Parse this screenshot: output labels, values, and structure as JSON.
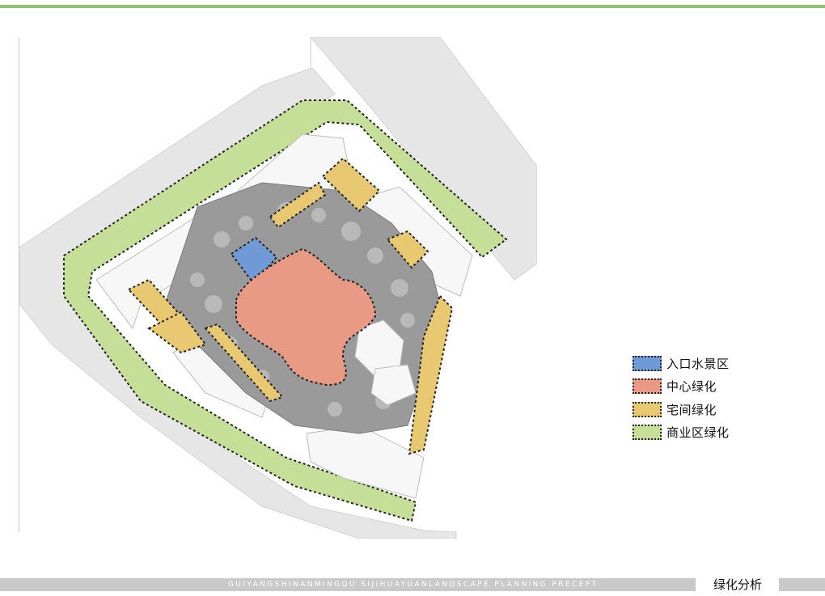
{
  "legend": {
    "items": [
      {
        "label": "入口水景区",
        "color": "#6f9ad6"
      },
      {
        "label": "中心绿化",
        "color": "#e89a84"
      },
      {
        "label": "宅间绿化",
        "color": "#e8c870"
      },
      {
        "label": "商业区绿化",
        "color": "#c5de98"
      }
    ]
  },
  "footer": {
    "subtitle": "GUIYANGSHINANMINGQU SIJIHUAYUANLANDSCAPE PLANNING PRECEPT",
    "title": "绿化分析"
  },
  "colors": {
    "accent_bar": "#8cc56e",
    "road": "#e6e6e6",
    "building": "#f7f7f7",
    "courtyard": "#9a9a9a"
  }
}
